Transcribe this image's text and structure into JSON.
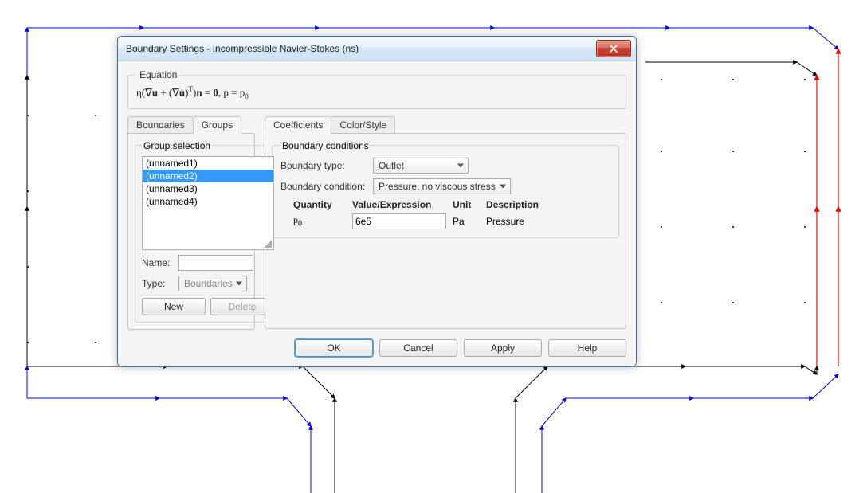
{
  "dialog": {
    "title": "Boundary Settings - Incompressible Navier-Stokes (ns)"
  },
  "equation": {
    "legend": "Equation",
    "text_html": "η(∇<span class='bold'>u</span> + (∇<span class='bold'>u</span>)<sup>T</sup>)<span class='bold'>n</span> = <span class='bold'>0</span>, p = p<sub>0</sub>"
  },
  "leftTabs": {
    "items": [
      "Boundaries",
      "Groups"
    ],
    "activeIndex": 1
  },
  "groupSelection": {
    "legend": "Group selection",
    "items": [
      "(unnamed1)",
      "(unnamed2)",
      "(unnamed3)",
      "(unnamed4)"
    ],
    "selectedIndex": 1,
    "nameLabel": "Name:",
    "nameValue": "",
    "typeLabel": "Type:",
    "typeValue": "Boundaries",
    "newLabel": "New",
    "deleteLabel": "Delete"
  },
  "rightTabs": {
    "items": [
      "Coefficients",
      "Color/Style"
    ],
    "activeIndex": 0
  },
  "boundaryConditions": {
    "legend": "Boundary conditions",
    "typeLabel": "Boundary type:",
    "typeValue": "Outlet",
    "condLabel": "Boundary condition:",
    "condValue": "Pressure, no viscous stress",
    "headers": {
      "q": "Quantity",
      "v": "Value/Expression",
      "u": "Unit",
      "d": "Description"
    },
    "row": {
      "quantity_html": "p<sub>0</sub>",
      "value": "6e5",
      "unit": "Pa",
      "desc": "Pressure"
    }
  },
  "footer": {
    "ok": "OK",
    "cancel": "Cancel",
    "apply": "Apply",
    "help": "Help"
  }
}
